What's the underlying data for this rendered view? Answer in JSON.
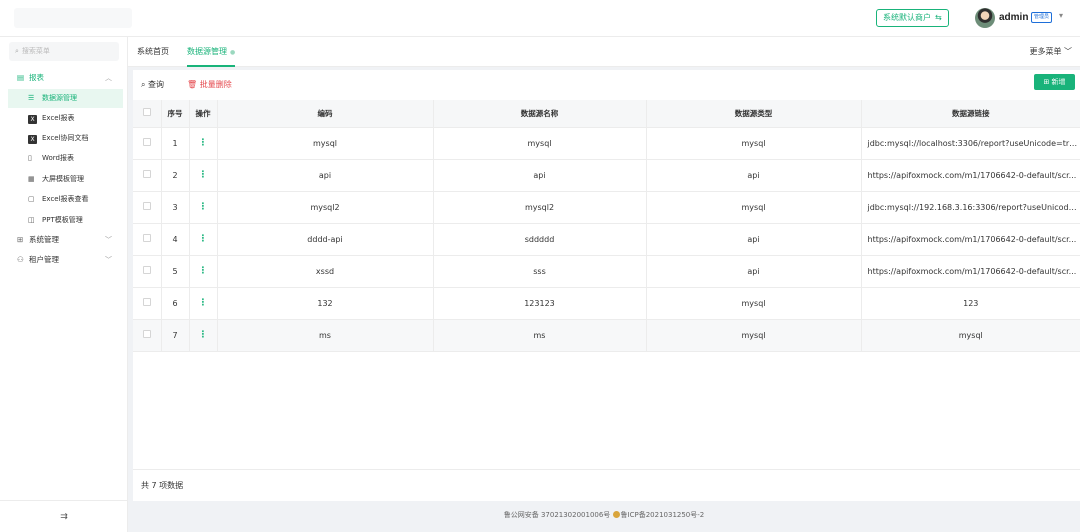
{
  "header": {
    "tenant_button": "系统默认商户",
    "switch_icon": "swap-icon",
    "user_name": "admin",
    "role_badge": "管理员"
  },
  "sidebar": {
    "search_placeholder": "搜索菜单",
    "groups": [
      {
        "label": "报表",
        "icon": "report-icon",
        "expanded": true
      },
      {
        "label": "系统管理",
        "icon": "grid-icon",
        "expanded": false
      },
      {
        "label": "租户管理",
        "icon": "users-icon",
        "expanded": false
      }
    ],
    "items": [
      {
        "label": "数据源管理",
        "icon": "database-icon",
        "active": true
      },
      {
        "label": "Excel报表",
        "icon": "excel-icon"
      },
      {
        "label": "Excel协同文档",
        "icon": "excel-icon"
      },
      {
        "label": "Word报表",
        "icon": "word-icon"
      },
      {
        "label": "大屏模板管理",
        "icon": "dashboard-icon"
      },
      {
        "label": "Excel报表查看",
        "icon": "file-view-icon"
      },
      {
        "label": "PPT模板管理",
        "icon": "ppt-icon"
      }
    ]
  },
  "tabs": [
    {
      "label": "系统首页",
      "active": false
    },
    {
      "label": "数据源管理",
      "active": true
    }
  ],
  "more_menu": "更多菜单",
  "toolbar": {
    "query": "查询",
    "batch_delete": "批量删除",
    "add": "新增"
  },
  "table": {
    "headers": [
      "序号",
      "操作",
      "编码",
      "数据源名称",
      "数据源类型",
      "数据源链接"
    ],
    "rows": [
      {
        "no": "1",
        "code": "mysql",
        "name": "mysql",
        "type": "mysql",
        "link": "jdbc:mysql://localhost:3306/report?useUnicode=tru..."
      },
      {
        "no": "2",
        "code": "api",
        "name": "api",
        "type": "api",
        "link": "https://apifoxmock.com/m1/1706642-0-default/scr..."
      },
      {
        "no": "3",
        "code": "mysql2",
        "name": "mysql2",
        "type": "mysql",
        "link": "jdbc:mysql://192.168.3.16:3306/report?useUnicode..."
      },
      {
        "no": "4",
        "code": "dddd-api",
        "name": "sddddd",
        "type": "api",
        "link": "https://apifoxmock.com/m1/1706642-0-default/scr..."
      },
      {
        "no": "5",
        "code": "xssd",
        "name": "sss",
        "type": "api",
        "link": "https://apifoxmock.com/m1/1706642-0-default/scr..."
      },
      {
        "no": "6",
        "code": "132",
        "name": "123123",
        "type": "mysql",
        "link": "123"
      },
      {
        "no": "7",
        "code": "ms",
        "name": "ms",
        "type": "mysql",
        "link": "mysql"
      }
    ],
    "total": "共 7 项数据"
  },
  "footer": {
    "police": "鲁公网安备 37021302001006号",
    "icp": "鲁ICP备2021031250号-2"
  },
  "colors": {
    "accent": "#19b37a",
    "danger": "#e5484d",
    "badge": "#1e6fd9"
  }
}
